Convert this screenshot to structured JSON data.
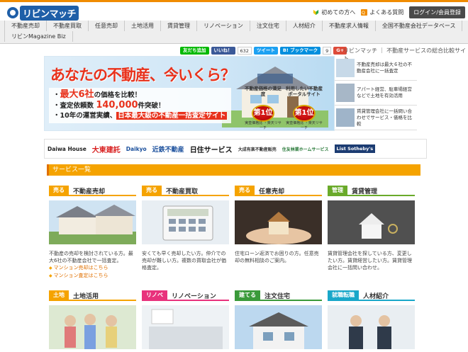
{
  "header": {
    "logo_text": "リビンマッチ",
    "links": {
      "first_time": "初めての方へ",
      "faq": "よくある質問",
      "login": "ログイン/会員登録"
    }
  },
  "nav": {
    "items": [
      "不動産売却",
      "不動産買取",
      "任意売却",
      "土地活用",
      "賃貸管理",
      "リノベーション",
      "注文住宅",
      "人材紹介",
      "不動産求人情報",
      "全国不動産会社データベース",
      "リビンMagazine Biz"
    ]
  },
  "social": {
    "line": "友だち追加",
    "like": "いいね！",
    "like_count": "632",
    "tweet": "ツイート",
    "bookmark": "B! ブックマーク",
    "bookmark_count": "9",
    "gplus": "G+"
  },
  "tagline": "リビンマッチ ｜ 不動産サービスの総合比較サイト",
  "hero": {
    "headline": "あなたの不動産、今いくら？",
    "point1_pre": "・",
    "point1_red": "最大6社",
    "point1_post": "の価格を比較！",
    "point2_pre": "・査定依頼数",
    "point2_num": "140,000",
    "point2_post": "件突破！",
    "point3_pre": "・10年の運営実績、",
    "point3_red": "日本最大級の不動産一括査定サイト",
    "medal1": {
      "label": "不動産価格の満足度",
      "rank": "第1位",
      "note": "実査価格比 ・楽天リサーチ"
    },
    "medal2": {
      "label": "利用したい不動産ポータルサイト",
      "rank": "第1位",
      "note": "実査価格比 ・楽天リサーチ"
    }
  },
  "side_items": [
    {
      "text": "不動産売却は最大６社の不動産会社に一括査定"
    },
    {
      "text": "アパート経営、駐車場経営などで土地を有効活用"
    },
    {
      "text": "賃貸管理会社に一括問い合わせでサービス・価格を比較"
    }
  ],
  "partners": [
    "Daiwa House",
    "大東建託",
    "Daikyo",
    "近鉄不動産",
    "日住サービス",
    "大成有楽不動産販売",
    "住友林業ホームサービス",
    "List Sotheby's"
  ],
  "services": {
    "heading": "サービス一覧",
    "cards": [
      {
        "tag": "売る",
        "title": "不動産売却",
        "desc": "不動産の売却を検討されている方。最大6社の不動産会社で一括査定。",
        "links": [
          "マンション売却はこちら",
          "マンション査定はこちら"
        ]
      },
      {
        "tag": "売る",
        "title": "不動産買取",
        "desc": "安くても早く売却したい方。仲介での売却が難しい方。複数の買取会社が価格査定。",
        "links": []
      },
      {
        "tag": "売る",
        "title": "任意売却",
        "desc": "住宅ローン返済でお困りの方。任意売却の無料相談のご案内。",
        "links": []
      },
      {
        "tag": "管理",
        "title": "賃貸管理",
        "desc": "賃貸管理会社を探している方、変更したい方。賃貸経営したい方。賃貸管理会社に一括問い合わせ。",
        "links": []
      },
      {
        "tag": "土地",
        "title": "土地活用",
        "desc": "",
        "links": []
      },
      {
        "tag": "リノベ",
        "title": "リノベーション",
        "desc": "",
        "links": []
      },
      {
        "tag": "建てる",
        "title": "注文住宅",
        "desc": "",
        "links": []
      },
      {
        "tag": "就職転職",
        "title": "人材紹介",
        "desc": "",
        "links": []
      }
    ]
  },
  "colors": {
    "accent": "#f08c00",
    "sell": "#f5a300",
    "manage": "#6aaa2a",
    "land": "#f5a300",
    "reno": "#e8327c",
    "build": "#3a9a3a",
    "job": "#19a7c9"
  }
}
